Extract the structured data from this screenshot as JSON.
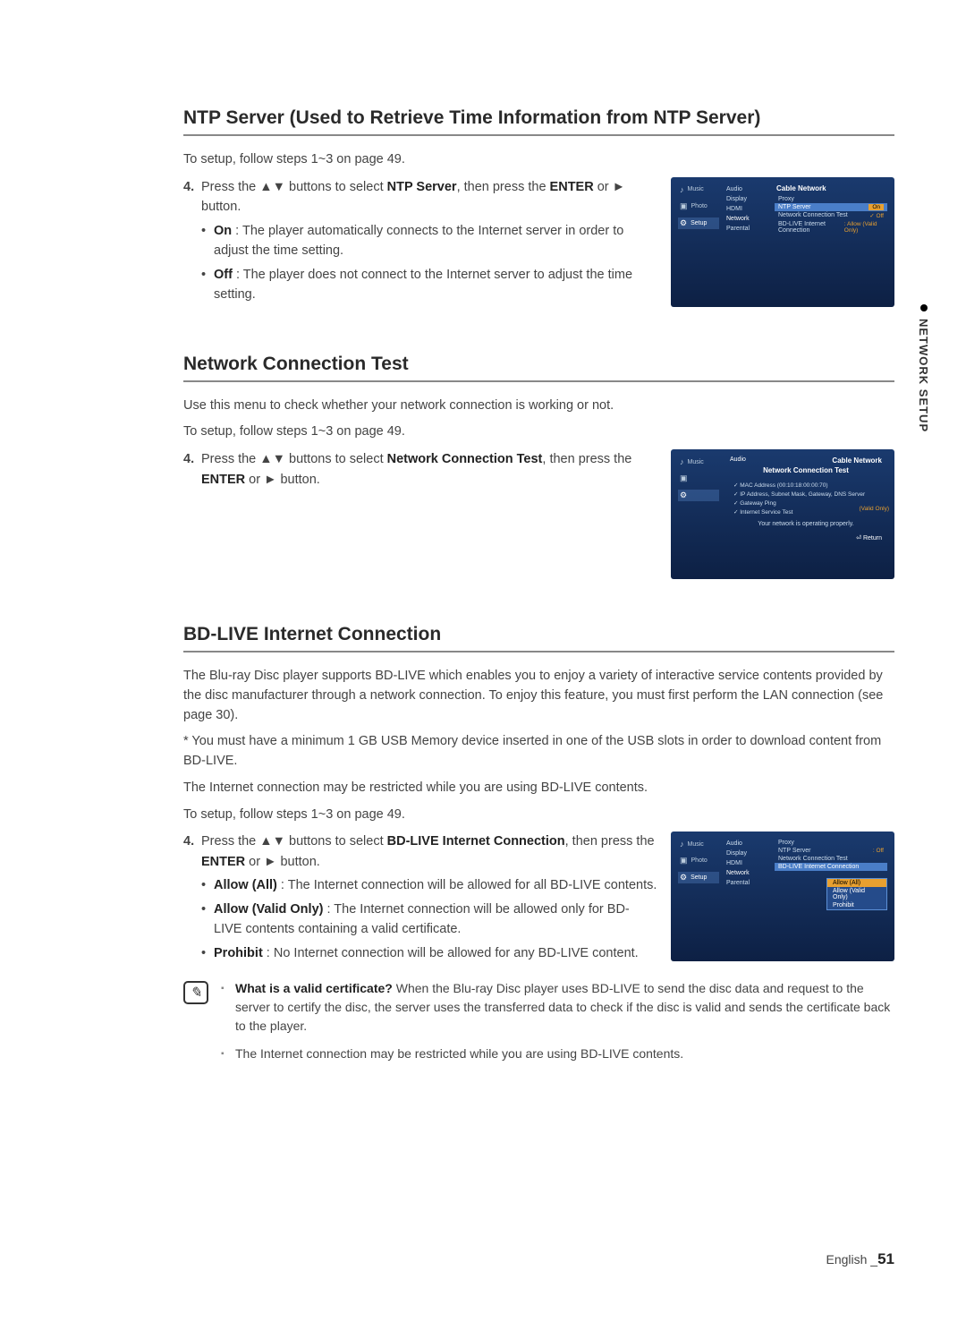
{
  "sideTab": {
    "label": "NETWORK SETUP"
  },
  "section1": {
    "title": "NTP Server (Used to Retrieve Time Information from NTP Server)",
    "intro": "To setup, follow steps 1~3 on page 49.",
    "step_num": "4.",
    "step_text_1": "Press the ▲▼ buttons to select ",
    "step_bold_1": "NTP Server",
    "step_text_2": ", then press the ",
    "step_bold_2": "ENTER",
    "step_text_3": " or ► button.",
    "bullets": [
      {
        "label": "On",
        "text": " : The player automatically connects to the Internet server in order to adjust the time setting."
      },
      {
        "label": "Off",
        "text": " : The player does not connect to the Internet server to adjust the time setting."
      }
    ],
    "screenshot": {
      "nav": [
        "Music",
        "Photo",
        "Setup"
      ],
      "midcol": [
        "Audio",
        "Display",
        "HDMI",
        "Network",
        "Parental"
      ],
      "rightTitle": "Cable Network",
      "rightItems": [
        {
          "label": "Proxy",
          "val": ""
        },
        {
          "label": "NTP Server",
          "val": "On",
          "hl": true
        },
        {
          "label": "Network Connection Test",
          "val": "✓ Off"
        },
        {
          "label": "BD-LIVE Internet Connection",
          "val": ": Allow (Valid Only)"
        }
      ]
    }
  },
  "section2": {
    "title": "Network Connection Test",
    "intro1": "Use this menu to check whether your network connection is working or not.",
    "intro2": "To setup, follow steps 1~3 on page 49.",
    "step_num": "4.",
    "step_text_1": "Press the ▲▼ buttons to select ",
    "step_bold_1": "Network Connection Test",
    "step_text_2": ", then press the ",
    "step_bold_2": "ENTER",
    "step_text_3": " or ► button.",
    "screenshot": {
      "nav": [
        "Music",
        "",
        ""
      ],
      "rightTitle": "Cable Network",
      "testTitle": "Network Connection Test",
      "testLines": [
        "✓ MAC Address (00:10:18:00:00:70)",
        "✓ IP Address, Subnet Mask, Gateway, DNS Server",
        "✓ Gateway Ping",
        "✓ Internet Service Test"
      ],
      "status": "Your network is operating properly.",
      "return": "Return",
      "sideFlag": "(Valid Only)"
    }
  },
  "section3": {
    "title": "BD-LIVE Internet Connection",
    "p1": "The Blu-ray Disc player supports BD-LIVE which enables you to enjoy a variety of interactive service contents provided by the disc manufacturer through a network connection. To enjoy this feature, you must first perform the LAN connection (see page 30).",
    "p2": "* You must have a minimum 1 GB USB Memory device inserted in one of the USB slots in order to download content from BD-LIVE.",
    "p3": "The Internet connection may be restricted while you are using BD-LIVE contents.",
    "intro": "To setup, follow steps 1~3 on page 49.",
    "step_num": "4.",
    "step_text_1": "Press the ▲▼ buttons to select ",
    "step_bold_1": "BD-LIVE Internet Connection",
    "step_text_2": ", then press the ",
    "step_bold_2": "ENTER",
    "step_text_3": " or ► button.",
    "bullets": [
      {
        "label": "Allow (All)",
        "text": " : The Internet connection will be allowed for all BD-LIVE contents."
      },
      {
        "label": "Allow (Valid Only)",
        "text": " : The Internet connection will be allowed only for BD-LIVE contents containing a valid certificate."
      },
      {
        "label": "Prohibit",
        "text": " : No Internet connection will be allowed for any BD-LIVE content."
      }
    ],
    "screenshot": {
      "nav": [
        "Music",
        "Photo",
        "Setup"
      ],
      "midcol": [
        "Audio",
        "Display",
        "HDMI",
        "Network",
        "Parental"
      ],
      "rightItems": [
        {
          "label": "Proxy",
          "val": ""
        },
        {
          "label": "NTP Server",
          "val": ": Off"
        },
        {
          "label": "Network Connection Test",
          "val": ""
        },
        {
          "label": "BD-LIVE Internet Connection",
          "val": "",
          "hl": true
        }
      ],
      "dropdown": [
        "Allow (All)",
        "Allow (Valid Only)",
        "Prohibit"
      ]
    },
    "notes": [
      {
        "bold": "What is a valid certificate?",
        "text": " When the Blu-ray Disc player uses BD-LIVE to send the disc data and request to the server to certify the disc, the server uses the transferred data to check if the disc is valid and sends the certificate back to the player."
      },
      {
        "bold": "",
        "text": "The Internet connection may be restricted while you are using BD-LIVE contents."
      }
    ]
  },
  "footer": {
    "lang": "English _",
    "page": "51"
  }
}
